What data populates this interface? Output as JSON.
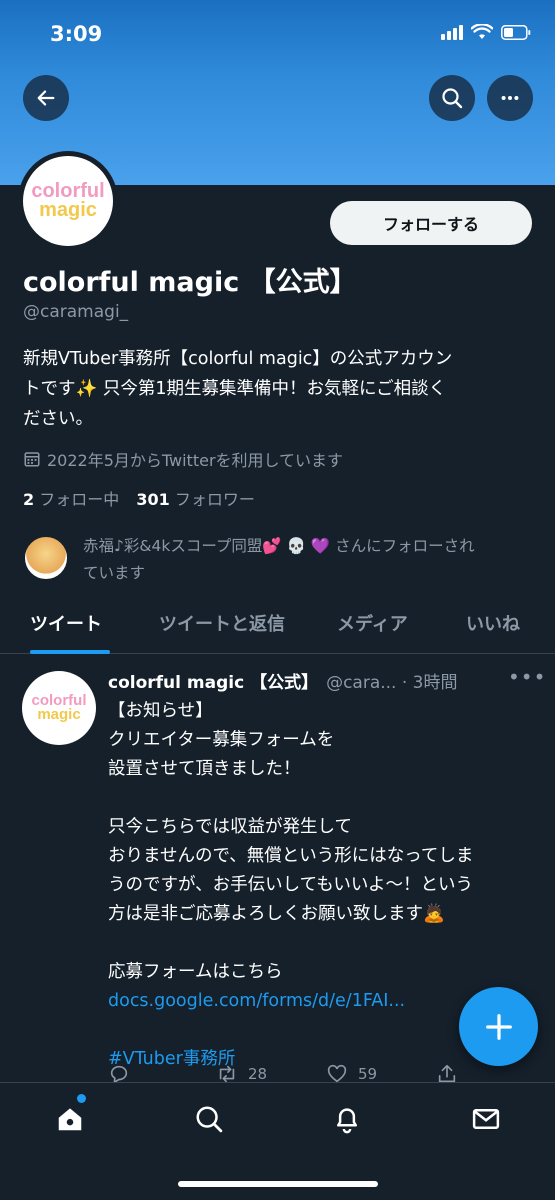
{
  "status_bar": {
    "time": "3:09"
  },
  "profile": {
    "display_name": "colorful magic 【公式】",
    "handle": "@caramagi_",
    "follow_button": "フォローする",
    "bio_lines": [
      "新規VTuber事務所【colorful magic】の公式アカウン",
      "トです✨ 只今第1期生募集準備中！お気軽にご相談く",
      "ださい。"
    ],
    "joined": "2022年5月からTwitterを利用しています",
    "following_count": "2",
    "following_label": "フォロー中",
    "followers_count": "301",
    "followers_label": "フォロワー",
    "followed_by_lines": [
      "赤福♪彩&4kスコープ同盟💕 💀 💜 さんにフォローされ",
      "ています"
    ],
    "logo_line1": "colorful",
    "logo_line2": "magic"
  },
  "tabs": [
    {
      "label": "ツイート",
      "active": true
    },
    {
      "label": "ツイートと返信",
      "active": false
    },
    {
      "label": "メディア",
      "active": false
    },
    {
      "label": "いいね",
      "active": false
    }
  ],
  "tweet": {
    "author_name": "colorful magic 【公式】",
    "author_meta": "@cara... · 3時間",
    "more": "•••",
    "lines": [
      "【お知らせ】",
      "クリエイター募集フォームを",
      "設置させて頂きました！",
      "",
      "只今こちらでは収益が発生して",
      "おりませんので、無償という形にはなってしま",
      "うのですが、お手伝いしてもいいよ〜！という",
      "方は是非ご応募よろしくお願い致します🙇",
      "",
      "応募フォームはこちら"
    ],
    "link": "docs.google.com/forms/d/e/1FAI...",
    "hashtag": "#VTuber事務所",
    "retweet_count": "28",
    "like_count": "59"
  },
  "icons": {
    "back": "arrow-left-icon",
    "search": "search-icon",
    "more": "more-icon",
    "calendar": "calendar-icon",
    "compose": "plus-icon",
    "home": "home-icon",
    "explore": "search-icon",
    "notifications": "bell-icon",
    "messages": "mail-icon"
  },
  "colors": {
    "accent": "#1d9bf0",
    "background": "#15202b",
    "secondary_text": "#8b98a5"
  }
}
